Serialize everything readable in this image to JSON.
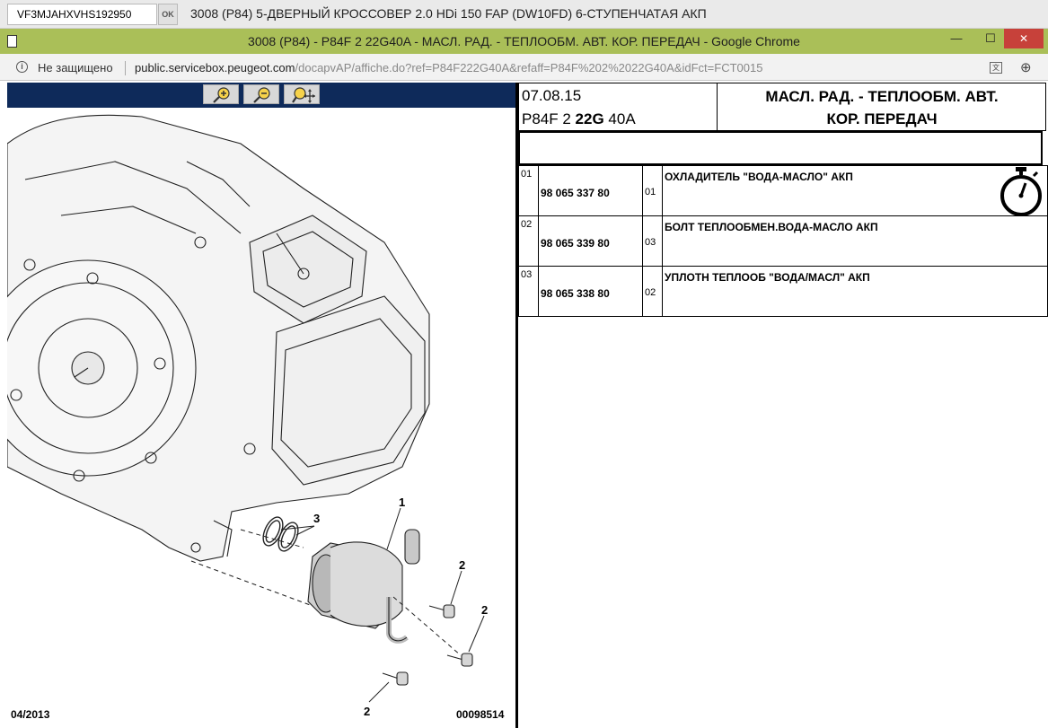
{
  "vin_bar": {
    "vin_value": "VF3MJAHXVHS192950",
    "ok_label": "OK",
    "vehicle_title": "3008 (P84) 5-ДВЕРНЫЙ КРОССОВЕР 2.0 HDi 150 FAP (DW10FD) 6-СТУПЕНЧАТАЯ АКП"
  },
  "window": {
    "title": "3008 (P84) - P84F 2 22G40A - МАСЛ. РАД. - ТЕПЛООБМ. АВТ. КОР. ПЕРЕДАЧ - Google Chrome",
    "minimize": "—",
    "maximize": "☐",
    "close": "✕"
  },
  "address_bar": {
    "security_label": "Не защищено",
    "url_host": "public.servicebox.peugeot.com",
    "url_path": "/docapvAP/affiche.do?ref=P84F222G40A&refaff=P84F%202%2022G40A&idFct=FCT0015"
  },
  "diagram": {
    "callouts": [
      "1",
      "2",
      "2",
      "2",
      "3"
    ],
    "date": "04/2013",
    "reference": "00098514"
  },
  "header": {
    "date": "07.08.15",
    "code_prefix": "P84F 2 ",
    "code_bold": "22G",
    "code_suffix": " 40A",
    "title_line1": "МАСЛ. РАД. - ТЕПЛООБМ. АВТ.",
    "title_line2": "КОР. ПЕРЕДАЧ"
  },
  "parts": [
    {
      "pos": "01",
      "ref": "98 065 337 80",
      "qty": "01",
      "desc": "ОХЛАДИТЕЛЬ \"ВОДА-МАСЛО\" АКП",
      "icon": "stopwatch-icon"
    },
    {
      "pos": "02",
      "ref": "98 065 339 80",
      "qty": "03",
      "desc": "БОЛТ ТЕПЛООБМЕН.ВОДА-МАСЛО АКП"
    },
    {
      "pos": "03",
      "ref": "98 065 338 80",
      "qty": "02",
      "desc": "УПЛОТН ТЕПЛООБ \"ВОДА/МАСЛ\" АКП"
    }
  ],
  "colors": {
    "chrome_title_bar": "#aabf58",
    "diagram_toolbar": "#0e2a5a",
    "close_button": "#c7413a"
  }
}
